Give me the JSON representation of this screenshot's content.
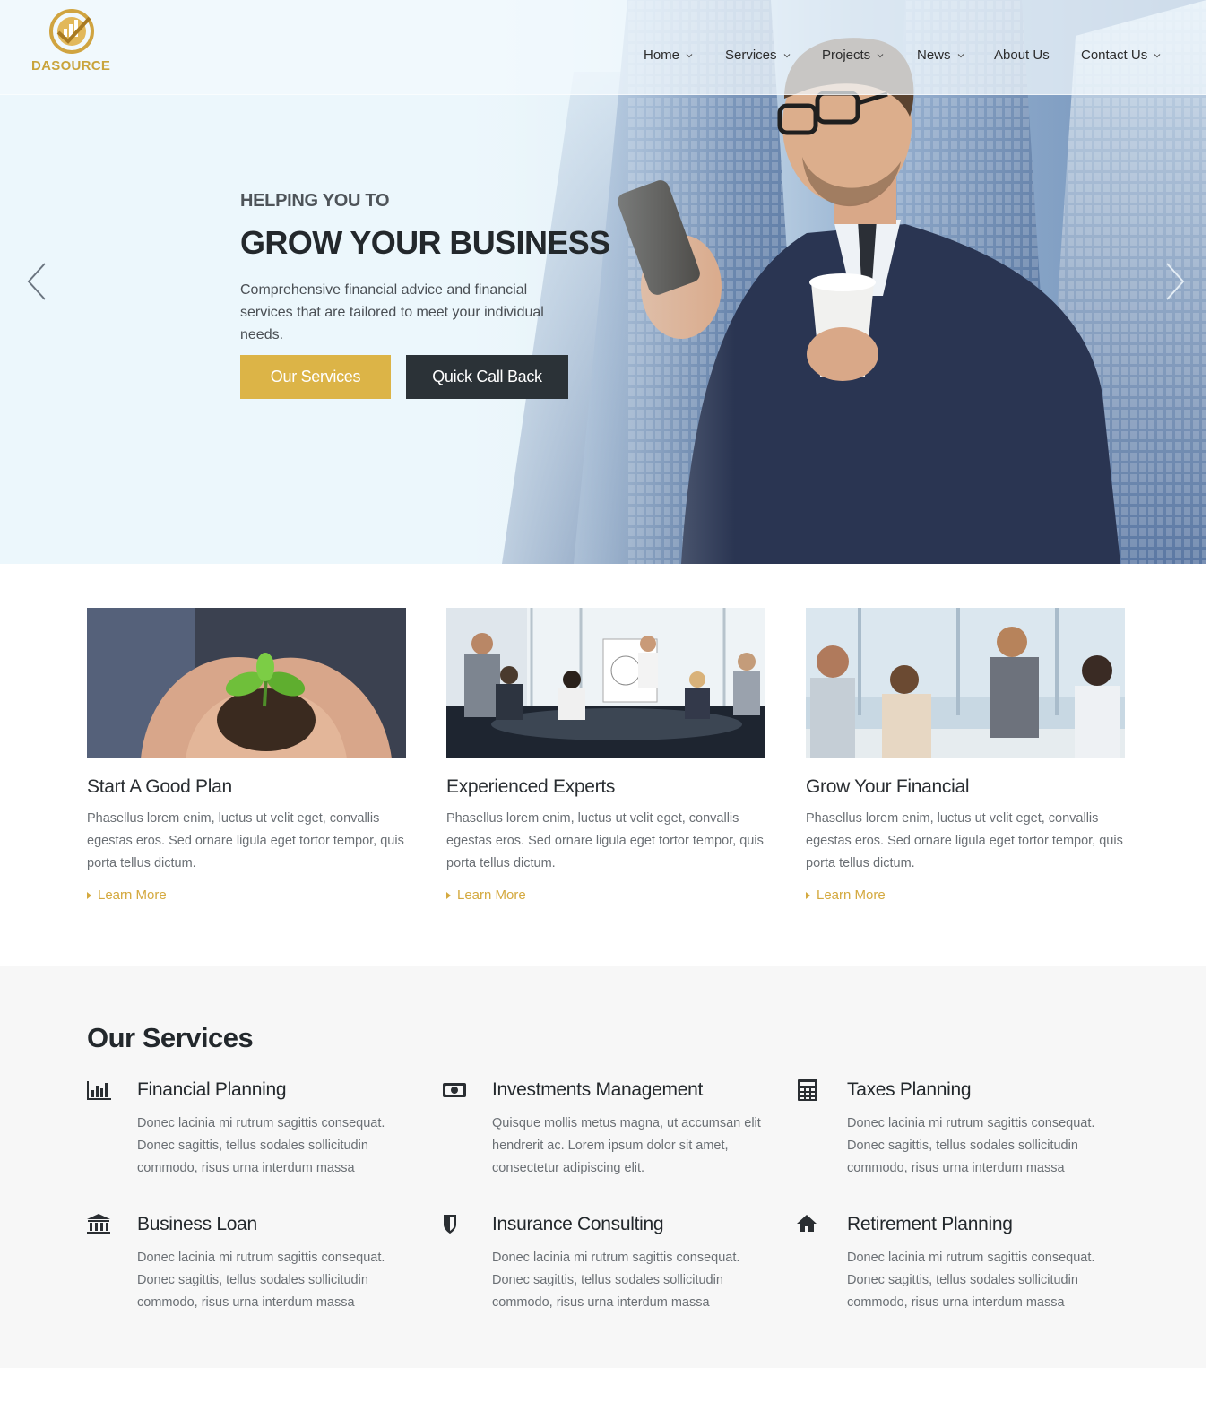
{
  "brand": {
    "name": "DASOURCE",
    "accent": "#dcb447",
    "dark": "#2b3237"
  },
  "nav": {
    "items": [
      {
        "label": "Home",
        "dropdown": true
      },
      {
        "label": "Services",
        "dropdown": true
      },
      {
        "label": "Projects",
        "dropdown": true
      },
      {
        "label": "News",
        "dropdown": true
      },
      {
        "label": "About Us",
        "dropdown": false
      },
      {
        "label": "Contact Us",
        "dropdown": true
      }
    ]
  },
  "hero": {
    "kicker": "HELPING YOU TO",
    "title": "GROW YOUR BUSINESS",
    "description": "Comprehensive financial advice and financial services that are tailored to meet your individual needs.",
    "primary_button": "Our Services",
    "secondary_button": "Quick Call Back"
  },
  "features": [
    {
      "title": "Start A Good Plan",
      "text": "Phasellus lorem enim, luctus ut velit eget, convallis egestas eros. Sed ornare ligula eget tortor tempor, quis porta tellus dictum.",
      "link": "Learn More"
    },
    {
      "title": "Experienced Experts",
      "text": "Phasellus lorem enim, luctus ut velit eget, convallis egestas eros. Sed ornare ligula eget tortor tempor, quis porta tellus dictum.",
      "link": "Learn More"
    },
    {
      "title": "Grow Your Financial",
      "text": "Phasellus lorem enim, luctus ut velit eget, convallis egestas eros. Sed ornare ligula eget tortor tempor, quis porta tellus dictum.",
      "link": "Learn More"
    }
  ],
  "services": {
    "title": "Our Services",
    "items": [
      {
        "icon": "bar-chart-icon",
        "title": "Financial Planning",
        "text": "Donec lacinia mi rutrum sagittis consequat. Donec sagittis, tellus sodales sollicitudin commodo, risus urna interdum massa"
      },
      {
        "icon": "money-icon",
        "title": "Investments Management",
        "text": "Quisque mollis metus magna, ut accumsan elit hendrerit ac. Lorem ipsum dolor sit amet, consectetur adipiscing elit."
      },
      {
        "icon": "calculator-icon",
        "title": "Taxes Planning",
        "text": "Donec lacinia mi rutrum sagittis consequat. Donec sagittis, tellus sodales sollicitudin commodo, risus urna interdum massa"
      },
      {
        "icon": "bank-icon",
        "title": "Business Loan",
        "text": "Donec lacinia mi rutrum sagittis consequat. Donec sagittis, tellus sodales sollicitudin commodo, risus urna interdum massa"
      },
      {
        "icon": "shield-icon",
        "title": "Insurance Consulting",
        "text": "Donec lacinia mi rutrum sagittis consequat. Donec sagittis, tellus sodales sollicitudin commodo, risus urna interdum massa"
      },
      {
        "icon": "home-icon",
        "title": "Retirement Planning",
        "text": "Donec lacinia mi rutrum sagittis consequat. Donec sagittis, tellus sodales sollicitudin commodo, risus urna interdum massa"
      }
    ]
  }
}
